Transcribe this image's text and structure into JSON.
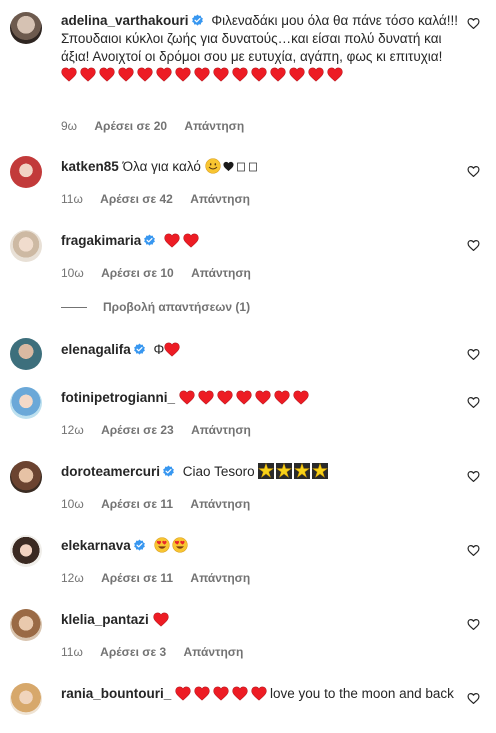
{
  "colors": {
    "heart": "#ed1c24",
    "verified": "#3897f0",
    "meta": "#737373"
  },
  "comments": [
    {
      "username": "adelina_varthakouri",
      "verified": true,
      "text": "Φιλεναδάκι μου όλα θα πάνε τόσο καλά!!!Σπουδαιοι κύκλοι ζωής για δυνατούς…και είσαι πολύ δυνατή και άξια! Ανοιχτοί οι δρόμοι σου με ευτυχία, αγάπη, φως κι επιτυχια!",
      "hearts_count": 15,
      "time": "9ω",
      "likes": "Αρέσει σε 20",
      "reply": "Απάντηση"
    },
    {
      "username": "katken85",
      "verified": false,
      "text": "Όλα για καλό",
      "suffix": "♥️🤍🤍",
      "time": "11ω",
      "likes": "Αρέσει σε 42",
      "reply": "Απάντηση"
    },
    {
      "username": "fragakimaria",
      "verified": true,
      "hearts_count": 2,
      "time": "10ω",
      "likes": "Αρέσει σε 10",
      "reply": "Απάντηση"
    },
    {
      "username": "elenagalifa",
      "verified": true,
      "text": "Φ",
      "hearts_count": 1
    },
    {
      "username": "fotinipetrogianni_",
      "verified": false,
      "hearts_count": 7,
      "time": "12ω",
      "likes": "Αρέσει σε 23",
      "reply": "Απάντηση"
    },
    {
      "username": "doroteamercuri",
      "verified": true,
      "text": "Ciao Tesoro",
      "stars_count": 4,
      "time": "10ω",
      "likes": "Αρέσει σε 11",
      "reply": "Απάντηση"
    },
    {
      "username": "elekarnava",
      "verified": true,
      "heart_eyes_count": 2,
      "time": "12ω",
      "likes": "Αρέσει σε 11",
      "reply": "Απάντηση"
    },
    {
      "username": "klelia_pantazi",
      "verified": false,
      "hearts_count": 1,
      "time": "11ω",
      "likes": "Αρέσει σε 3",
      "reply": "Απάντηση"
    },
    {
      "username": "rania_bountouri_",
      "verified": false,
      "hearts_count": 5,
      "text_after": "love you to the moon and back"
    }
  ],
  "view_replies": "Προβολή απαντήσεων (1)",
  "icons": {
    "like": "heart-outline-icon",
    "verified": "verified-badge-icon"
  }
}
